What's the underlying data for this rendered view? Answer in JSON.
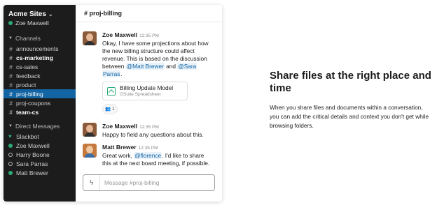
{
  "sidebar": {
    "workspace_name": "Acme Sites",
    "current_user": "Zoe Maxwell",
    "channels_heading": "Channels",
    "channels": [
      {
        "name": "announcements",
        "bold": false,
        "active": false
      },
      {
        "name": "cs-marketing",
        "bold": true,
        "active": false
      },
      {
        "name": "cs-sales",
        "bold": false,
        "active": false
      },
      {
        "name": "feedback",
        "bold": false,
        "active": false
      },
      {
        "name": "product",
        "bold": false,
        "active": false
      },
      {
        "name": "proj-billing",
        "bold": false,
        "active": true
      },
      {
        "name": "proj-coupons",
        "bold": false,
        "active": false
      },
      {
        "name": "team-cs",
        "bold": true,
        "active": false
      }
    ],
    "dm_heading": "Direct Messages",
    "direct_messages": [
      {
        "name": "Slackbot",
        "status": "heart"
      },
      {
        "name": "Zoe Maxwell",
        "status": "online"
      },
      {
        "name": "Harry Boone",
        "status": "away"
      },
      {
        "name": "Sara Parras",
        "status": "away"
      },
      {
        "name": "Matt Brewer",
        "status": "online"
      }
    ]
  },
  "channel": {
    "header": "# proj-billing"
  },
  "messages": [
    {
      "author": "Zoe Maxwell",
      "time": "12:35 PM",
      "text_lines": [
        "Okay, I have some projections about how",
        "the new billing structure could affect",
        "revenue. This is based on the discussion"
      ],
      "between_word": "between",
      "mention_1": "@Matt Brewer",
      "and_word": "and",
      "mention_2": "@Sara",
      "mention_2b": "Parras",
      "end_punct": ".",
      "attachment": {
        "title": "Billing Update Model",
        "subtitle": "GSuite Spreadsheet"
      },
      "reaction": {
        "emoji": "👥",
        "count": "1"
      }
    },
    {
      "author": "Zoe Maxwell",
      "time": "12:35 PM",
      "text": "Happy to field any questions about this."
    },
    {
      "author": "Matt Brewer",
      "time": "12:35 PM",
      "text_start": "Great work,",
      "mention": "@florence",
      "text_end": ". I'd like to share",
      "text_line2": "this at the next board meeting, if possible."
    }
  ],
  "composer": {
    "placeholder": "Message #proj-billing"
  },
  "promo": {
    "title": "Share files at the right place and time",
    "body": "When you share files and documents within a conversation, you can add the critical details and context you don't get while browsing folders."
  },
  "colors": {
    "sidebar_bg": "#1d1c1d",
    "active_channel": "#1264a3",
    "online": "#2bac76",
    "mention": "#1264a3"
  }
}
